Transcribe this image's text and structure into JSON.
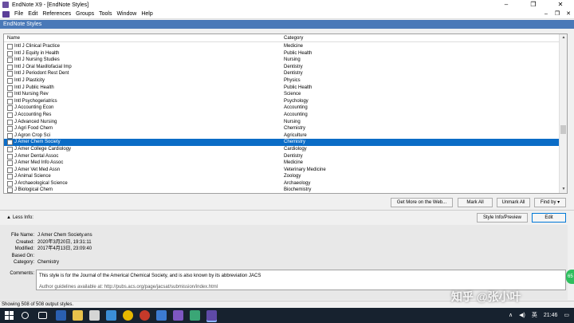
{
  "window": {
    "title": "EndNote X9 - [EndNote Styles]",
    "controls": [
      "–",
      "❐",
      "✕"
    ]
  },
  "menubar": {
    "items": [
      "File",
      "Edit",
      "References",
      "Groups",
      "Tools",
      "Window",
      "Help"
    ],
    "mdi_controls": [
      "–",
      "❐",
      "✕"
    ]
  },
  "dialog": {
    "title": "EndNote Styles"
  },
  "list": {
    "columns": [
      "Name",
      "Category"
    ],
    "rows": [
      {
        "name": "Intl J Clinical Practice",
        "category": "Medicine"
      },
      {
        "name": "Intl J Equity in Health",
        "category": "Public Health"
      },
      {
        "name": "Intl J Nursing Studies",
        "category": "Nursing"
      },
      {
        "name": "Intl J Oral Maxillofacial Imp",
        "category": "Dentistry"
      },
      {
        "name": "Intl J Periodont Rest Dent",
        "category": "Dentistry"
      },
      {
        "name": "Intl J Plasticity",
        "category": "Physics"
      },
      {
        "name": "Intl J Public Health",
        "category": "Public Health"
      },
      {
        "name": "Intl Nursing Rev",
        "category": "Science"
      },
      {
        "name": "Intl Psychogeriatrics",
        "category": "Psychology"
      },
      {
        "name": "J Accounting Econ",
        "category": "Accounting"
      },
      {
        "name": "J Accounting Res",
        "category": "Accounting"
      },
      {
        "name": "J Advanced Nursing",
        "category": "Nursing"
      },
      {
        "name": "J Agri Food Chem",
        "category": "Chemistry"
      },
      {
        "name": "J Agron Crop Sci",
        "category": "Agriculture"
      },
      {
        "name": "J Amer Chem Society",
        "category": "Chemistry",
        "selected": true
      },
      {
        "name": "J Amer College Cardiology",
        "category": "Cardiology"
      },
      {
        "name": "J Amer Dental Assoc",
        "category": "Dentistry"
      },
      {
        "name": "J Amer Med Info Assoc",
        "category": "Medicine"
      },
      {
        "name": "J Amer Vet Med Assn",
        "category": "Veterinary Medicine"
      },
      {
        "name": "J Animal Science",
        "category": "Zoology"
      },
      {
        "name": "J Archaeological Science",
        "category": "Archaeology"
      },
      {
        "name": "J Biological Chem",
        "category": "Biochemistry"
      }
    ]
  },
  "buttons": {
    "get_more": "Get More on the Web...",
    "mark_all": "Mark All",
    "unmark_all": "Unmark All",
    "find_by": "Find by",
    "style_info": "Style Info/Preview",
    "edit": "Edit"
  },
  "info": {
    "toggle_label": "Less Info:",
    "file_name_label": "File Name:",
    "file_name": "J Amer Chem Society.ens",
    "created_label": "Created:",
    "created": "2020年3月20日, 19:31:11",
    "modified_label": "Modified:",
    "modified": "2017年4月13日, 23:09:40",
    "based_on_label": "Based On:",
    "based_on": "",
    "category_label": "Category:",
    "category": "Chemistry",
    "comments_label": "Comments:",
    "comments_line1": "This style is for the Journal of the Americal Chemical Society, and is also known by its abbreviation JACS",
    "comments_line2": "Author guidelines available at: http://pubs.acs.org/page/jacsat/submission/index.html"
  },
  "status": {
    "text": "Showing 508 of 508 output styles."
  },
  "taskbar": {
    "ime": "英",
    "time": "21:46"
  },
  "overlay": {
    "watermark": "知乎 @张小叶",
    "badge": "65"
  }
}
